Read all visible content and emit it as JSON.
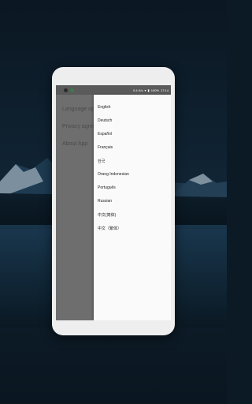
{
  "status_bar": {
    "network_speed": "0.4 K/s",
    "battery": "100%",
    "time": "17:14"
  },
  "background_menu": {
    "items": [
      {
        "label": "Language options"
      },
      {
        "label": "Privacy agreement"
      },
      {
        "label": "About App"
      }
    ]
  },
  "language_menu": {
    "items": [
      {
        "label": "English"
      },
      {
        "label": "Deutsch"
      },
      {
        "label": "Español"
      },
      {
        "label": "Français"
      },
      {
        "label": "한국"
      },
      {
        "label": "Orang Indonesian"
      },
      {
        "label": "Português"
      },
      {
        "label": "Russian"
      },
      {
        "label": "中文(简体)"
      },
      {
        "label": "中文（繁体）"
      }
    ]
  }
}
